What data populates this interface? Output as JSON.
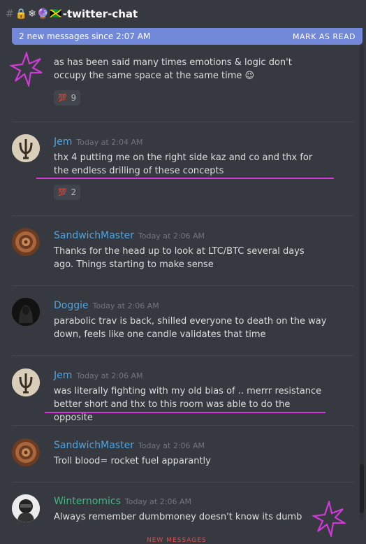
{
  "channel": {
    "hash": "#",
    "emojis": [
      "🔒",
      "❄",
      "🔮",
      "🇯🇲"
    ],
    "name": "-twitter-chat"
  },
  "banner": {
    "text": "2 new messages since 2:07 AM",
    "action": "MARK AS READ"
  },
  "messages": [
    {
      "id": "m0",
      "username": "",
      "timestamp": "",
      "text": "as has been said many times emotions & logic don't occupy the same space at the same time 😉",
      "reaction": {
        "emoji": "💯",
        "count": "9"
      }
    },
    {
      "id": "m1",
      "username": "Jem",
      "name_color": "#4fa3dd",
      "timestamp": "Today at 2:04 AM",
      "text": "thx 4 putting me on the right side kaz and co and thx for the endless drilling of these concepts",
      "reaction": {
        "emoji": "💯",
        "count": "2"
      }
    },
    {
      "id": "m2",
      "username": "SandwichMaster",
      "name_color": "#4fa3dd",
      "timestamp": "Today at 2:06 AM",
      "text": "Thanks for the head up to look at LTC/BTC several days ago. Things starting to make sense"
    },
    {
      "id": "m3",
      "username": "Doggie",
      "name_color": "#4fa3dd",
      "timestamp": "Today at 2:06 AM",
      "text": "parabolic trav is back, shilled everyone to death on the way down, feels like one candle validates that time"
    },
    {
      "id": "m4",
      "username": "Jem",
      "name_color": "#4fa3dd",
      "timestamp": "Today at 2:06 AM",
      "text": "was literally fighting with my old bias of .. merrr resistance better short and thx to this room was able to do the opposite"
    },
    {
      "id": "m5",
      "username": "SandwichMaster",
      "name_color": "#4fa3dd",
      "timestamp": "Today at 2:06 AM",
      "text": "Troll blood= rocket fuel apparantly"
    },
    {
      "id": "m6",
      "username": "Winternomics",
      "name_color": "#43b581",
      "timestamp": "Today at 2:06 AM",
      "text": "Always remember dumbmoney doesn't know its dumb"
    }
  ],
  "colors": {
    "background": "#36393f",
    "banner": "#7289da",
    "annotation": "#d13ad8",
    "reaction_bg": "#40444b"
  },
  "icons": {
    "annotation_star": "star-icon",
    "reaction": "hundred-points-icon"
  },
  "footer": {
    "new_messages_divider": "NEW MESSAGES"
  }
}
